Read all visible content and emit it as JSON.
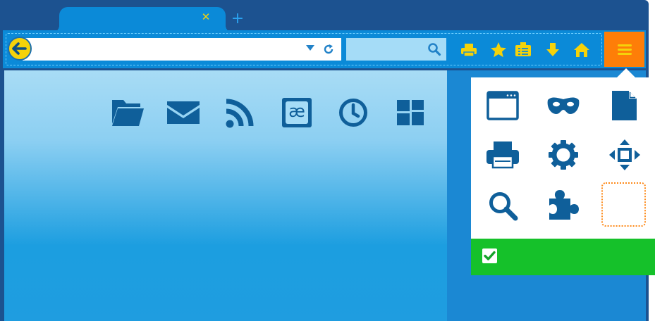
{
  "tabs": [
    {
      "title": "",
      "close_icon": "close-icon",
      "close_color": "#f5d20a"
    }
  ],
  "new_tab_icon": "plus-icon",
  "navbar": {
    "back_icon": "back-arrow-icon",
    "url_value": "",
    "search_value": "",
    "toolbar_icons": [
      "printer-icon",
      "star-icon",
      "reading-list-icon",
      "download-icon",
      "home-icon"
    ],
    "menu_icon": "hamburger-menu-icon"
  },
  "content_icons": [
    "folder-icon",
    "mail-icon",
    "rss-icon",
    "text-encoding-icon",
    "history-clock-icon",
    "dashboard-icon"
  ],
  "encoding_glyph": "æ",
  "menu_panel": {
    "items": [
      "new-window-icon",
      "private-browsing-mask-icon",
      "new-page-icon",
      "print-icon",
      "settings-gear-icon",
      "fullscreen-icon",
      "find-icon",
      "addons-puzzle-icon"
    ],
    "empty_slot": true,
    "footer_icon": "checkmark-icon"
  },
  "colors": {
    "frame": "#1c5290",
    "toolbar": "#0b8ad8",
    "accent_yellow": "#f5d20a",
    "menu_button": "#fe7e08",
    "icon_blue": "#0f5f9a",
    "footer_green": "#15c12a"
  }
}
